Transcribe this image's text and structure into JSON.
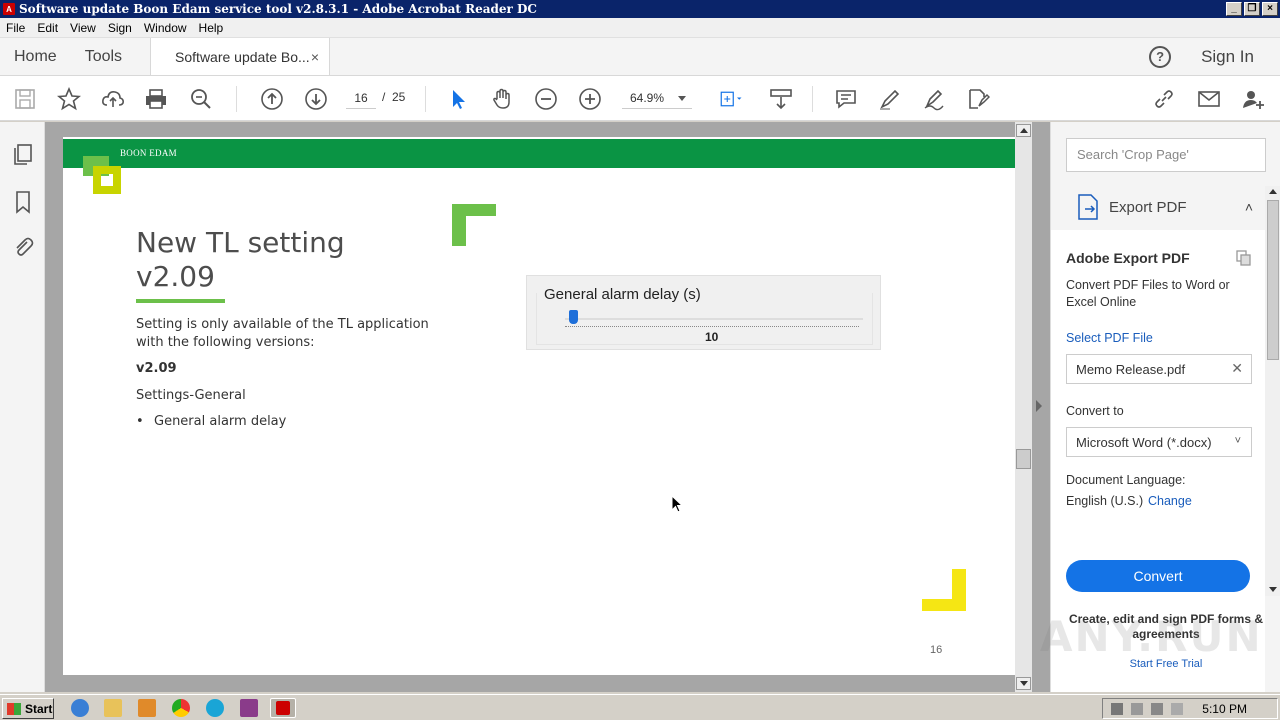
{
  "window": {
    "title": "Software update Boon Edam service tool v2.8.3.1 - Adobe Acrobat Reader DC",
    "buttons": [
      "minimize",
      "restore",
      "close"
    ]
  },
  "menubar": [
    "File",
    "Edit",
    "View",
    "Sign",
    "Window",
    "Help"
  ],
  "tabs": {
    "home": "Home",
    "tools": "Tools",
    "document": "Software update Bo...",
    "close": "×",
    "help": "?",
    "sign_in": "Sign In"
  },
  "toolbar": {
    "current_page": "16",
    "separator": "/",
    "total_pages": "25",
    "zoom": "64.9%"
  },
  "page": {
    "logo_text": "BOON EDAM",
    "title_line1": "New TL setting",
    "title_line2": "v2.09",
    "intro": "Setting is only available of the TL application with the following versions:",
    "version": "v2.09",
    "section": "Settings-General",
    "bullet": "General alarm delay",
    "bullet_mark": "•",
    "page_number": "16",
    "alarm_widget": {
      "label": "General alarm delay (s)",
      "value": "10",
      "slider_fraction": 0.03
    }
  },
  "right_pane": {
    "search_placeholder": "Search 'Crop Page'",
    "export_label": "Export PDF",
    "card_title": "Adobe Export PDF",
    "description": "Convert PDF Files to Word or Excel Online",
    "select_file": "Select PDF File",
    "file_name": "Memo Release.pdf",
    "convert_to_label": "Convert to",
    "convert_to_value": "Microsoft Word (*.docx)",
    "doc_lang_label": "Document Language:",
    "doc_lang_value": "English (U.S.)",
    "change_link": "Change",
    "convert_button": "Convert",
    "promo": "Create, edit and sign PDF forms & agreements",
    "trial_link": "Start Free Trial"
  },
  "watermark": "ANY.RUN",
  "taskbar": {
    "start": "Start",
    "clock": "5:10 PM"
  },
  "colors": {
    "brand_green": "#0a9444",
    "accent_blue": "#1473e6",
    "link_blue": "#1a5dbc",
    "logo_lime": "#c8d400",
    "logo_green": "#6cc04a",
    "yellow_corner": "#f5e614"
  }
}
